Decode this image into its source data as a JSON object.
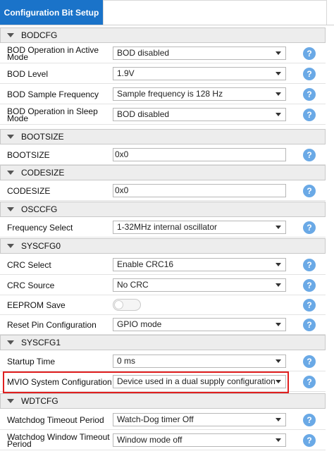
{
  "tab": {
    "active_label": "Configuration Bit Setup"
  },
  "sections": {
    "bodcfg": "BODCFG",
    "bootsize": "BOOTSIZE",
    "codesize": "CODESIZE",
    "osccfg": "OSCCFG",
    "syscfg0": "SYSCFG0",
    "syscfg1": "SYSCFG1",
    "wdtcfg": "WDTCFG"
  },
  "rows": {
    "bod_active": {
      "label": "BOD Operation in Active Mode",
      "value": "BOD disabled"
    },
    "bod_level": {
      "label": "BOD Level",
      "value": "1.9V"
    },
    "bod_sample": {
      "label": "BOD Sample Frequency",
      "value": "Sample frequency is 128 Hz"
    },
    "bod_sleep": {
      "label": "BOD Operation in Sleep Mode",
      "value": "BOD disabled"
    },
    "bootsize": {
      "label": "BOOTSIZE",
      "value": "0x0"
    },
    "codesize": {
      "label": "CODESIZE",
      "value": "0x0"
    },
    "freq_select": {
      "label": "Frequency Select",
      "value": "1-32MHz internal oscillator"
    },
    "crc_select": {
      "label": "CRC Select",
      "value": "Enable CRC16"
    },
    "crc_source": {
      "label": "CRC Source",
      "value": "No CRC"
    },
    "eeprom_save": {
      "label": "EEPROM Save",
      "checked": false
    },
    "reset_pin": {
      "label": "Reset Pin Configuration",
      "value": "GPIO mode"
    },
    "startup_time": {
      "label": "Startup Time",
      "value": "0 ms"
    },
    "mvio": {
      "label": "MVIO System Configuration",
      "value": "Device used in a dual supply configuration"
    },
    "wdt_timeout": {
      "label": "Watchdog Timeout Period",
      "value": "Watch-Dog timer Off"
    },
    "wdt_window": {
      "label": "Watchdog Window Timeout Period",
      "value": "Window mode off"
    }
  },
  "help_glyph": "?",
  "colors": {
    "tab_active": "#1a73c9",
    "help_icon": "#6aa9e6",
    "highlight": "#e01f1f",
    "section_bg": "#ededed"
  }
}
